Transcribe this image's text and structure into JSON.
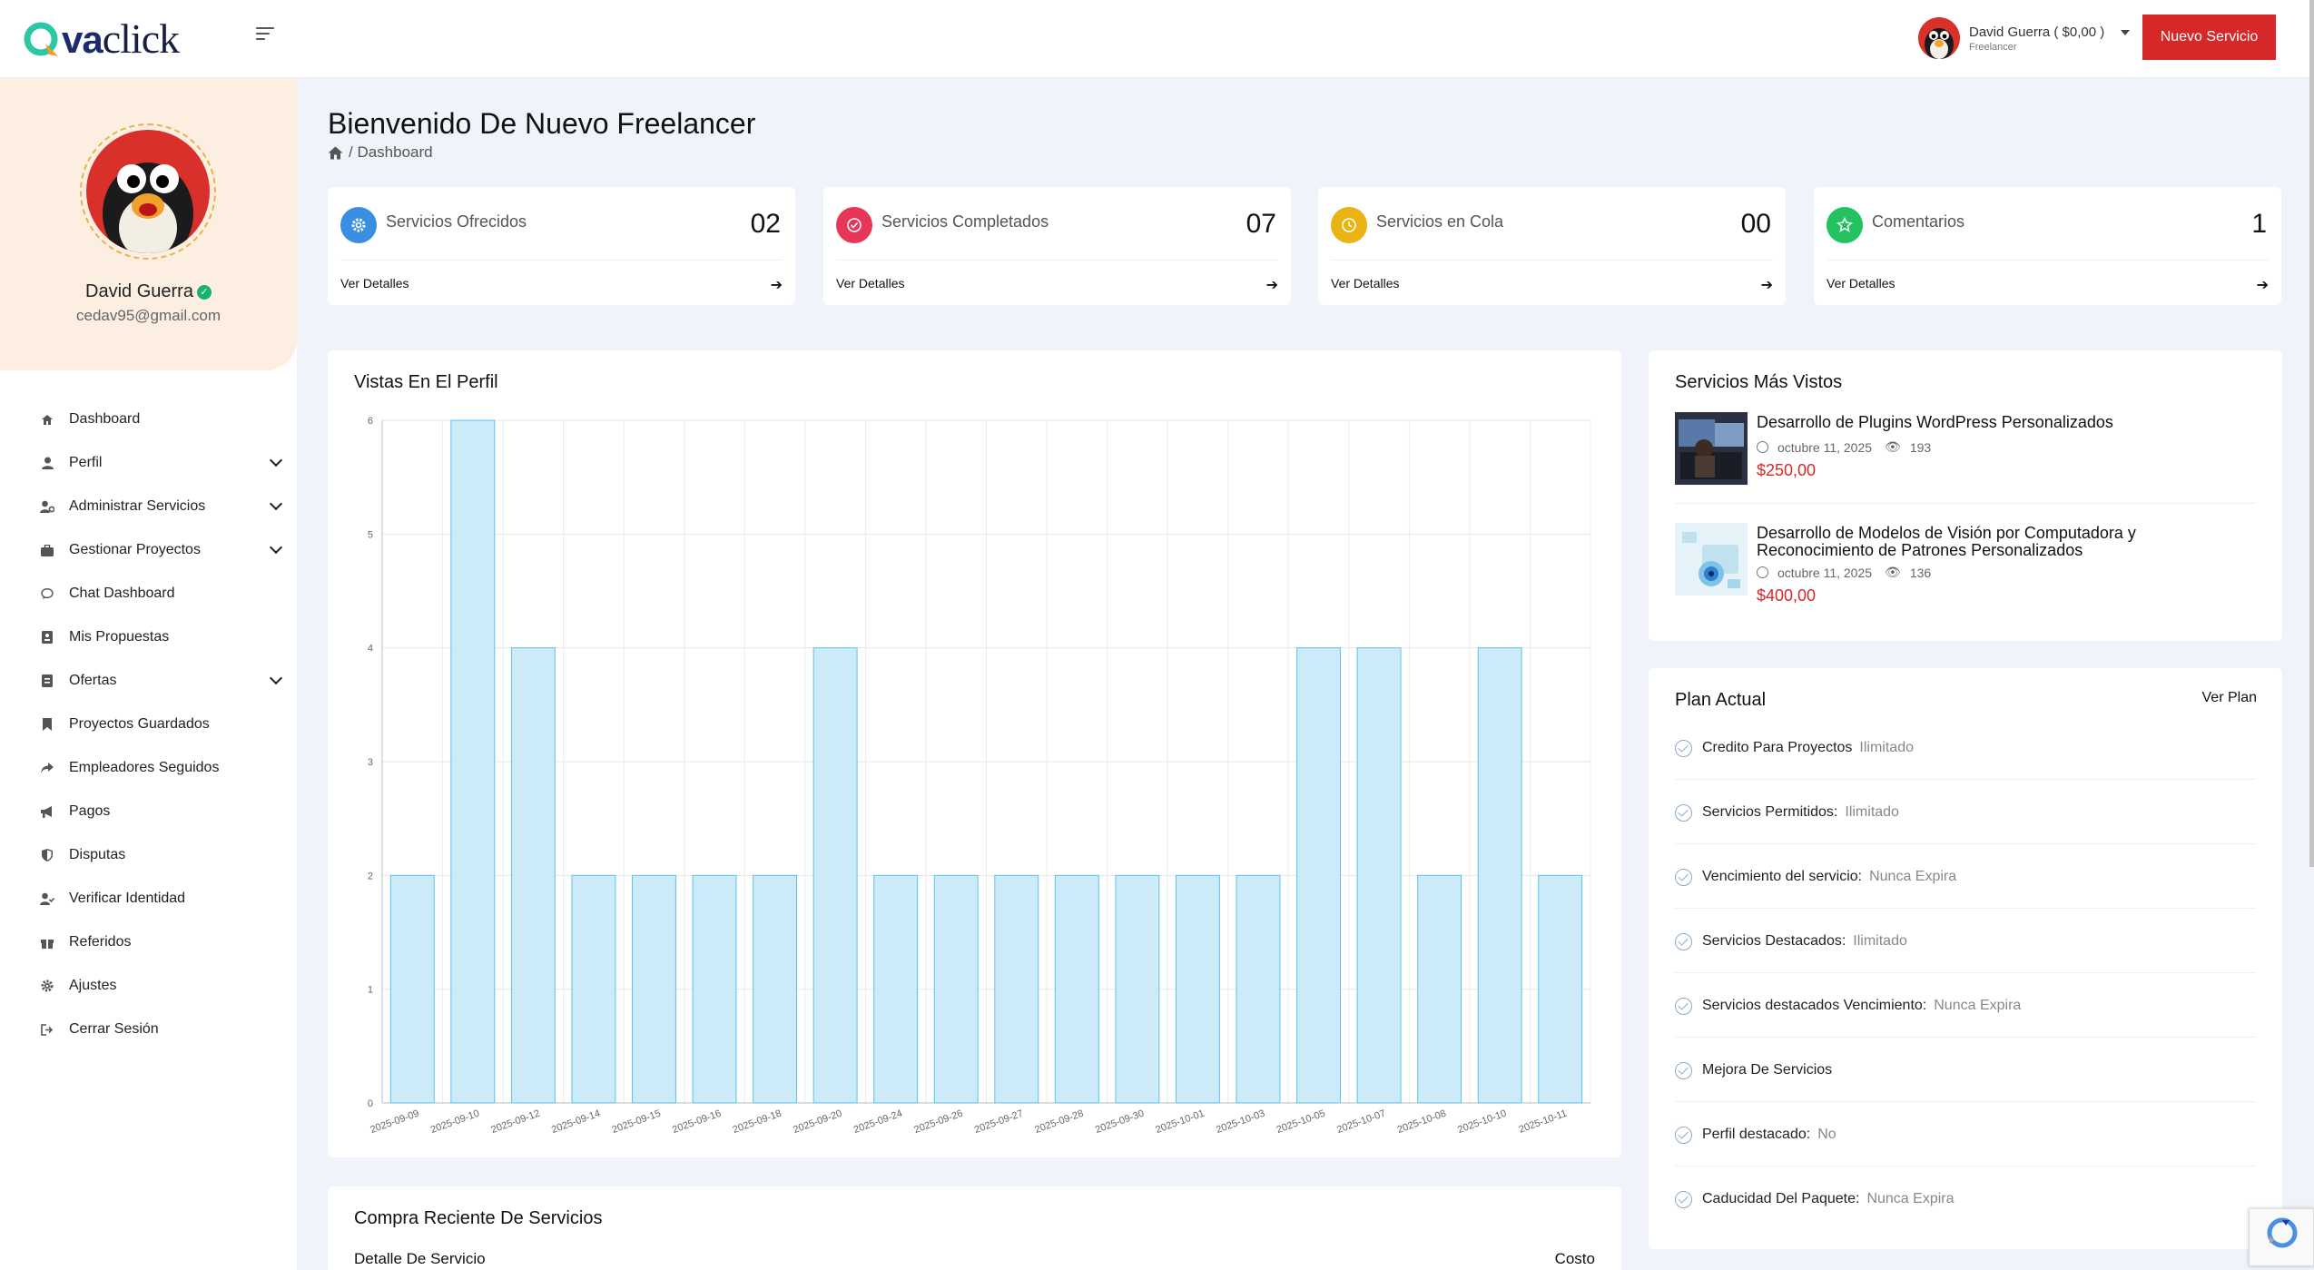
{
  "header": {
    "logo": {
      "va": "va",
      "click": "click"
    },
    "user_label": "David Guerra ( $0,00 )",
    "user_role": "Freelancer",
    "new_service_label": "Nuevo Servicio"
  },
  "profile": {
    "name": "David Guerra",
    "email": "cedav95@gmail.com"
  },
  "sidebar": {
    "items": [
      {
        "label": "Dashboard",
        "icon": "home-icon",
        "chevron": false
      },
      {
        "label": "Perfil",
        "icon": "user-icon",
        "chevron": true
      },
      {
        "label": "Administrar Servicios",
        "icon": "user-gear-icon",
        "chevron": true
      },
      {
        "label": "Gestionar Proyectos",
        "icon": "briefcase-icon",
        "chevron": true
      },
      {
        "label": "Chat Dashboard",
        "icon": "chat-icon",
        "chevron": false
      },
      {
        "label": "Mis Propuestas",
        "icon": "id-card-icon",
        "chevron": false
      },
      {
        "label": "Ofertas",
        "icon": "file-icon",
        "chevron": true
      },
      {
        "label": "Proyectos Guardados",
        "icon": "bookmark-icon",
        "chevron": false
      },
      {
        "label": "Empleadores Seguidos",
        "icon": "share-icon",
        "chevron": false
      },
      {
        "label": "Pagos",
        "icon": "megaphone-icon",
        "chevron": false
      },
      {
        "label": "Disputas",
        "icon": "shield-icon",
        "chevron": false
      },
      {
        "label": "Verificar Identidad",
        "icon": "user-check-icon",
        "chevron": false
      },
      {
        "label": "Referidos",
        "icon": "gift-icon",
        "chevron": false
      },
      {
        "label": "Ajustes",
        "icon": "gear-icon",
        "chevron": false
      },
      {
        "label": "Cerrar Sesión",
        "icon": "logout-icon",
        "chevron": false
      }
    ]
  },
  "page": {
    "title": "Bienvenido De Nuevo Freelancer",
    "breadcrumb": "/ Dashboard"
  },
  "stats": [
    {
      "label": "Servicios Ofrecidos",
      "value": "02",
      "link": "Ver Detalles",
      "color": "#3b8fe0",
      "icon": "gear-icon"
    },
    {
      "label": "Servicios Completados",
      "value": "07",
      "link": "Ver Detalles",
      "color": "#e73657",
      "icon": "check-circle-icon"
    },
    {
      "label": "Servicios en Cola",
      "value": "00",
      "link": "Ver Detalles",
      "color": "#e8b313",
      "icon": "clock-icon"
    },
    {
      "label": "Comentarios",
      "value": "1",
      "link": "Ver Detalles",
      "color": "#22c35e",
      "icon": "star-icon"
    }
  ],
  "chart_panel": {
    "title": "Vistas En El Perfil"
  },
  "chart_data": {
    "type": "bar",
    "categories": [
      "2025-09-09",
      "2025-09-10",
      "2025-09-12",
      "2025-09-14",
      "2025-09-15",
      "2025-09-16",
      "2025-09-18",
      "2025-09-20",
      "2025-09-24",
      "2025-09-26",
      "2025-09-27",
      "2025-09-28",
      "2025-09-30",
      "2025-10-01",
      "2025-10-03",
      "2025-10-05",
      "2025-10-07",
      "2025-10-08",
      "2025-10-10",
      "2025-10-11"
    ],
    "values": [
      2,
      6,
      4,
      2,
      2,
      2,
      2,
      4,
      2,
      2,
      2,
      2,
      2,
      2,
      2,
      4,
      4,
      2,
      4,
      2
    ],
    "ylim": [
      0,
      6
    ],
    "yticks": [
      "0",
      "1",
      "2",
      "3",
      "4",
      "5",
      "6"
    ],
    "grid": true,
    "bar_fill": "#cdeaf8",
    "bar_stroke": "#5bc3ec"
  },
  "most_viewed": {
    "title": "Servicios Más Vistos",
    "items": [
      {
        "title": "Desarrollo de Plugins WordPress Personalizados",
        "date": "octubre 11, 2025",
        "views": "193",
        "price": "$250,00"
      },
      {
        "title": "Desarrollo de Modelos de Visión por Computadora y Reconocimiento de Patrones Personalizados",
        "date": "octubre 11, 2025",
        "views": "136",
        "price": "$400,00"
      }
    ]
  },
  "plan": {
    "title": "Plan Actual",
    "link": "Ver Plan",
    "rows": [
      {
        "label": "Credito Para Proyectos",
        "value": "Ilimitado"
      },
      {
        "label": "Servicios Permitidos:",
        "value": "Ilimitado"
      },
      {
        "label": "Vencimiento del servicio:",
        "value": "Nunca Expira"
      },
      {
        "label": "Servicios Destacados:",
        "value": "Ilimitado"
      },
      {
        "label": "Servicios destacados Vencimiento:",
        "value": "Nunca Expira"
      },
      {
        "label": "Mejora De Servicios",
        "value": ""
      },
      {
        "label": "Perfil destacado:",
        "value": "No"
      },
      {
        "label": "Caducidad Del Paquete:",
        "value": "Nunca Expira"
      }
    ]
  },
  "recent": {
    "title": "Compra Reciente De Servicios",
    "col_detail": "Detalle De Servicio",
    "col_cost": "Costo"
  }
}
